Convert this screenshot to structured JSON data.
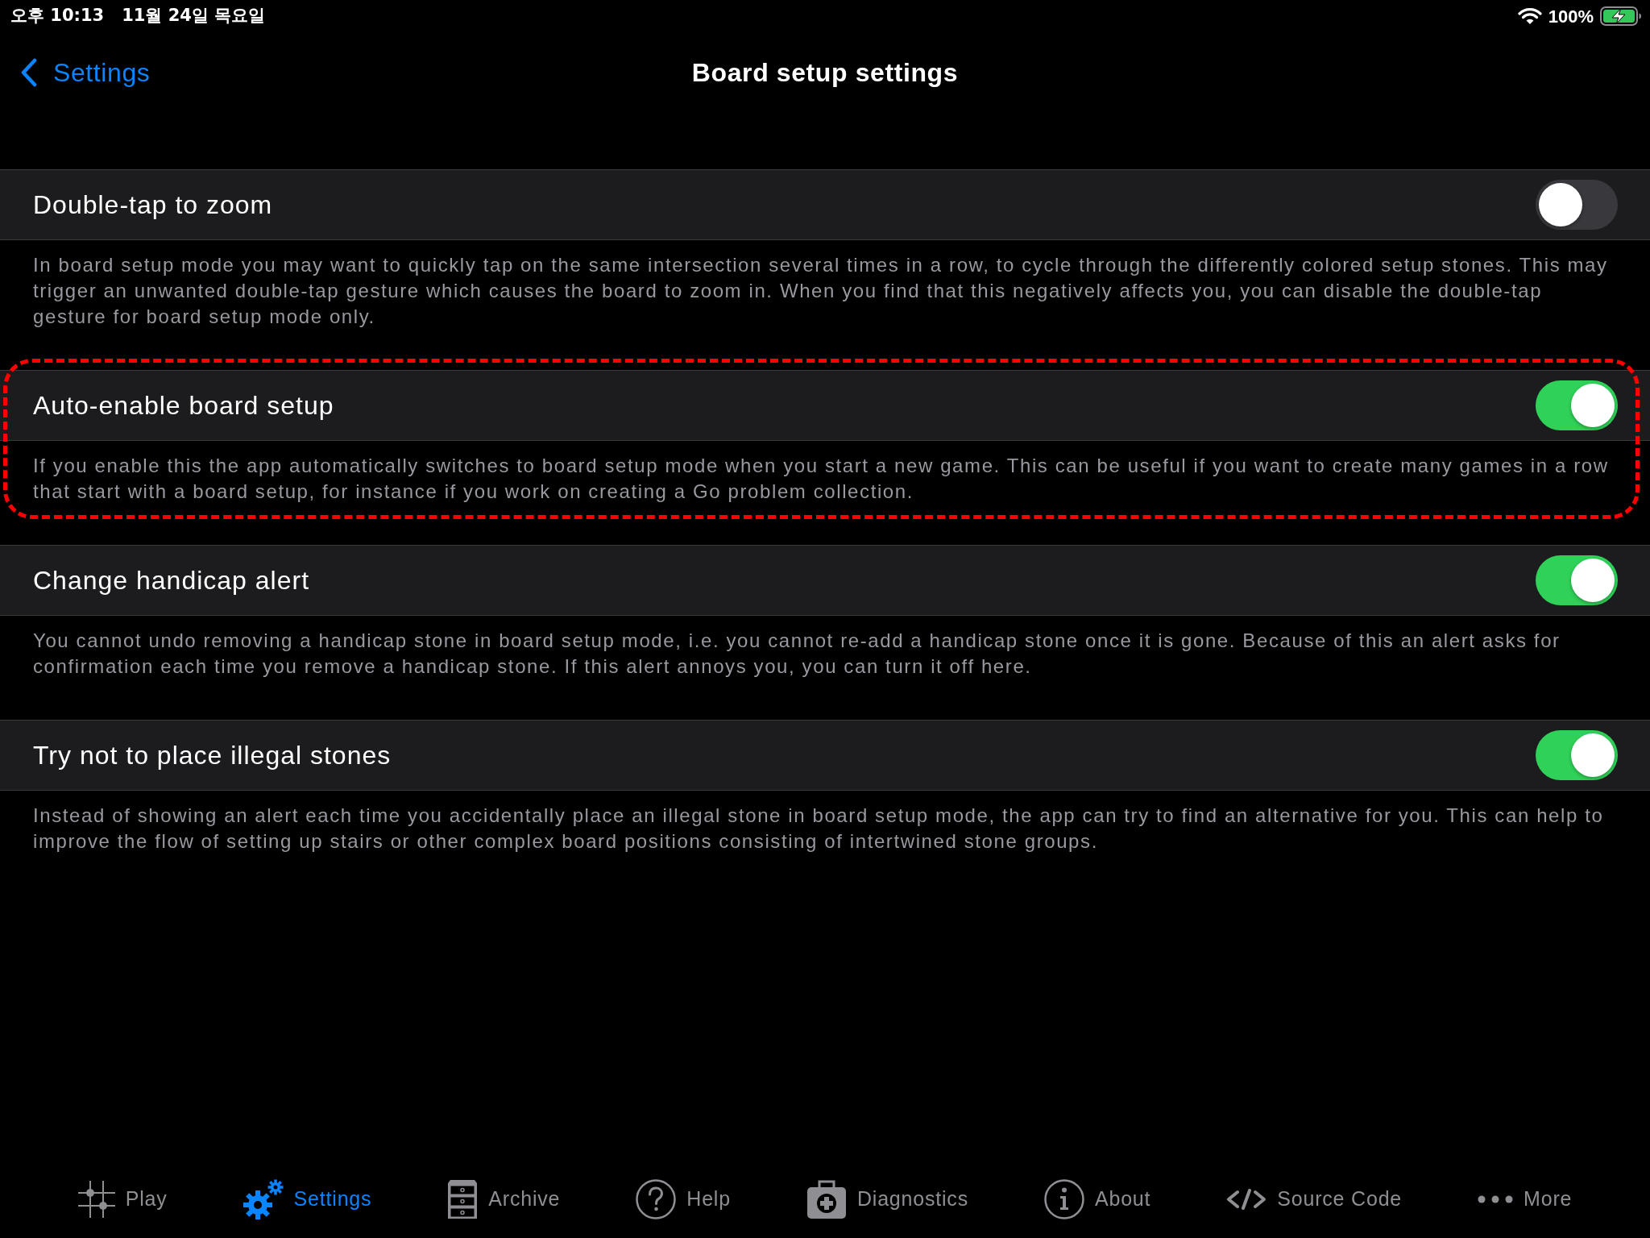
{
  "status_bar": {
    "time": "오후 10:13",
    "date": "11월 24일 목요일",
    "battery": "100%"
  },
  "nav": {
    "back": "Settings",
    "title": "Board setup settings"
  },
  "sections": [
    {
      "title": "Double-tap to zoom",
      "on": false,
      "highlighted": false,
      "footer": "In board setup mode you may want to quickly tap on the same intersection several times in a row, to cycle through the differently colored setup stones. This may trigger an unwanted double-tap gesture which causes the board to zoom in. When you find that this negatively affects you, you can disable the double-tap gesture for board setup mode only."
    },
    {
      "title": "Auto-enable board setup",
      "on": true,
      "highlighted": true,
      "footer": "If you enable this the app automatically switches to board setup mode when you start a new game. This can be useful if you want to create many games in a row that start with a board setup, for instance if you work on creating a Go problem collection."
    },
    {
      "title": "Change handicap alert",
      "on": true,
      "highlighted": false,
      "footer": "You cannot undo removing a handicap stone in board setup mode, i.e. you cannot re-add a handicap stone once it is gone. Because of this an alert asks for confirmation each time you remove a handicap stone. If this alert annoys you, you can turn it off here."
    },
    {
      "title": "Try not to place illegal stones",
      "on": true,
      "highlighted": false,
      "footer": "Instead of showing an alert each time you accidentally place an illegal stone in board setup mode, the app can try to find an alternative for you. This can help to improve the flow of setting up stairs or other complex board positions consisting of intertwined stone groups."
    }
  ],
  "tab_bar": [
    {
      "kind": "board",
      "label": "Play",
      "selected": false
    },
    {
      "kind": "gears",
      "label": "Settings",
      "selected": true
    },
    {
      "kind": "cabinet",
      "label": "Archive",
      "selected": false
    },
    {
      "kind": "question",
      "label": "Help",
      "selected": false
    },
    {
      "kind": "medkit",
      "label": "Diagnostics",
      "selected": false
    },
    {
      "kind": "info",
      "label": "About",
      "selected": false
    },
    {
      "kind": "code",
      "label": "Source Code",
      "selected": false
    },
    {
      "kind": "dots",
      "label": "More",
      "selected": false
    }
  ]
}
